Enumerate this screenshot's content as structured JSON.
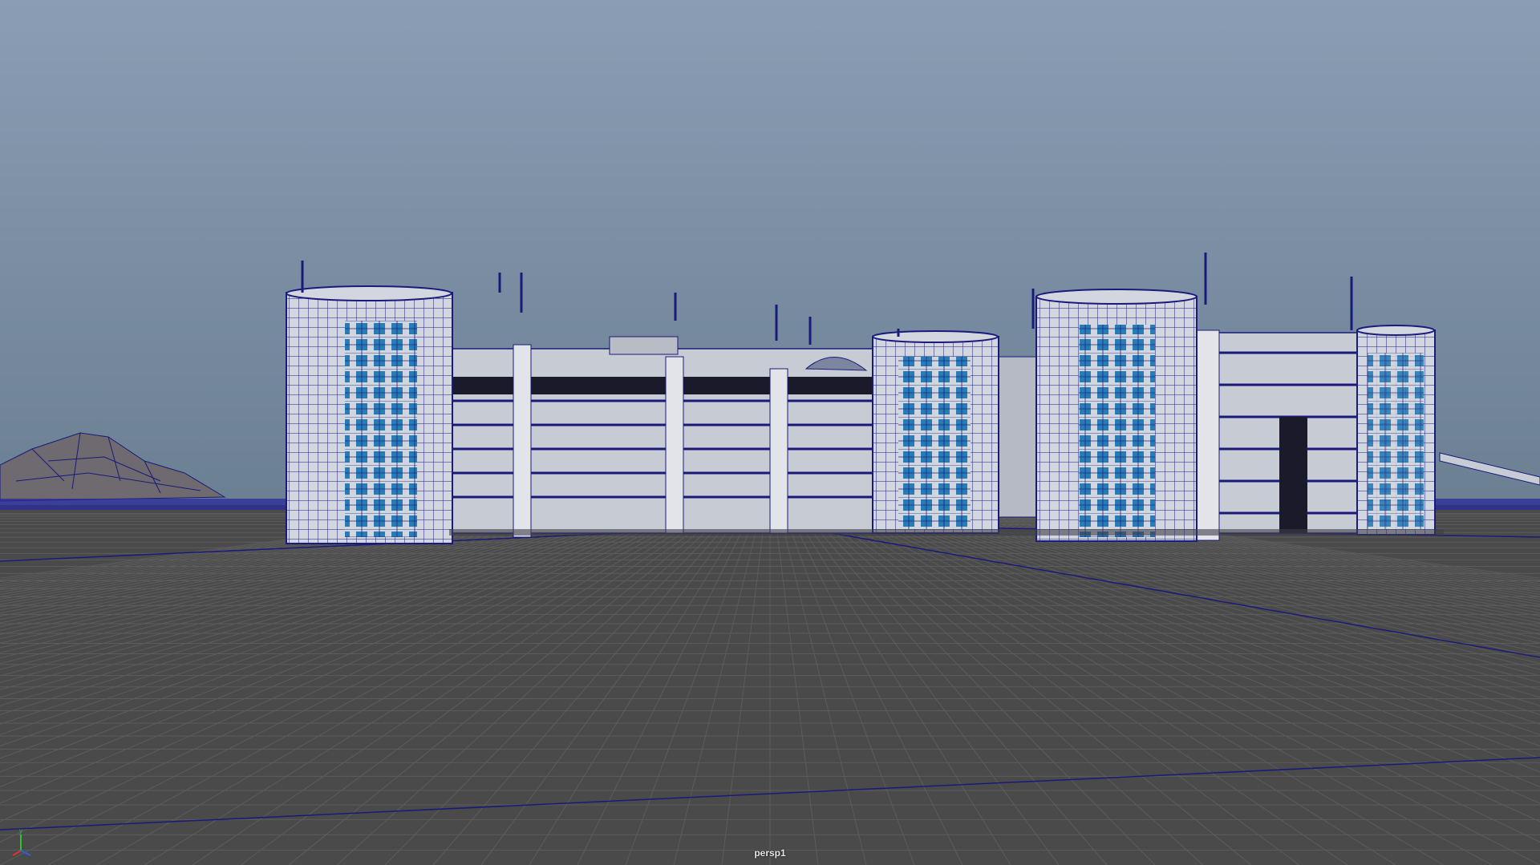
{
  "viewport": {
    "camera_name": "persp1",
    "colors": {
      "sky_top": "#8a9db4",
      "sky_bottom": "#6b7f93",
      "ground": "#4a4a4a",
      "grid_line": "#5c5c5c",
      "wire": "#1a1a7a",
      "building_face": "#d2d6de",
      "window": "#1e78b4",
      "axis_x": "#e03030",
      "axis_y": "#30c030",
      "axis_z": "#3060e0"
    },
    "axis_labels": {
      "x": "x",
      "y": "y",
      "z": "z"
    }
  }
}
